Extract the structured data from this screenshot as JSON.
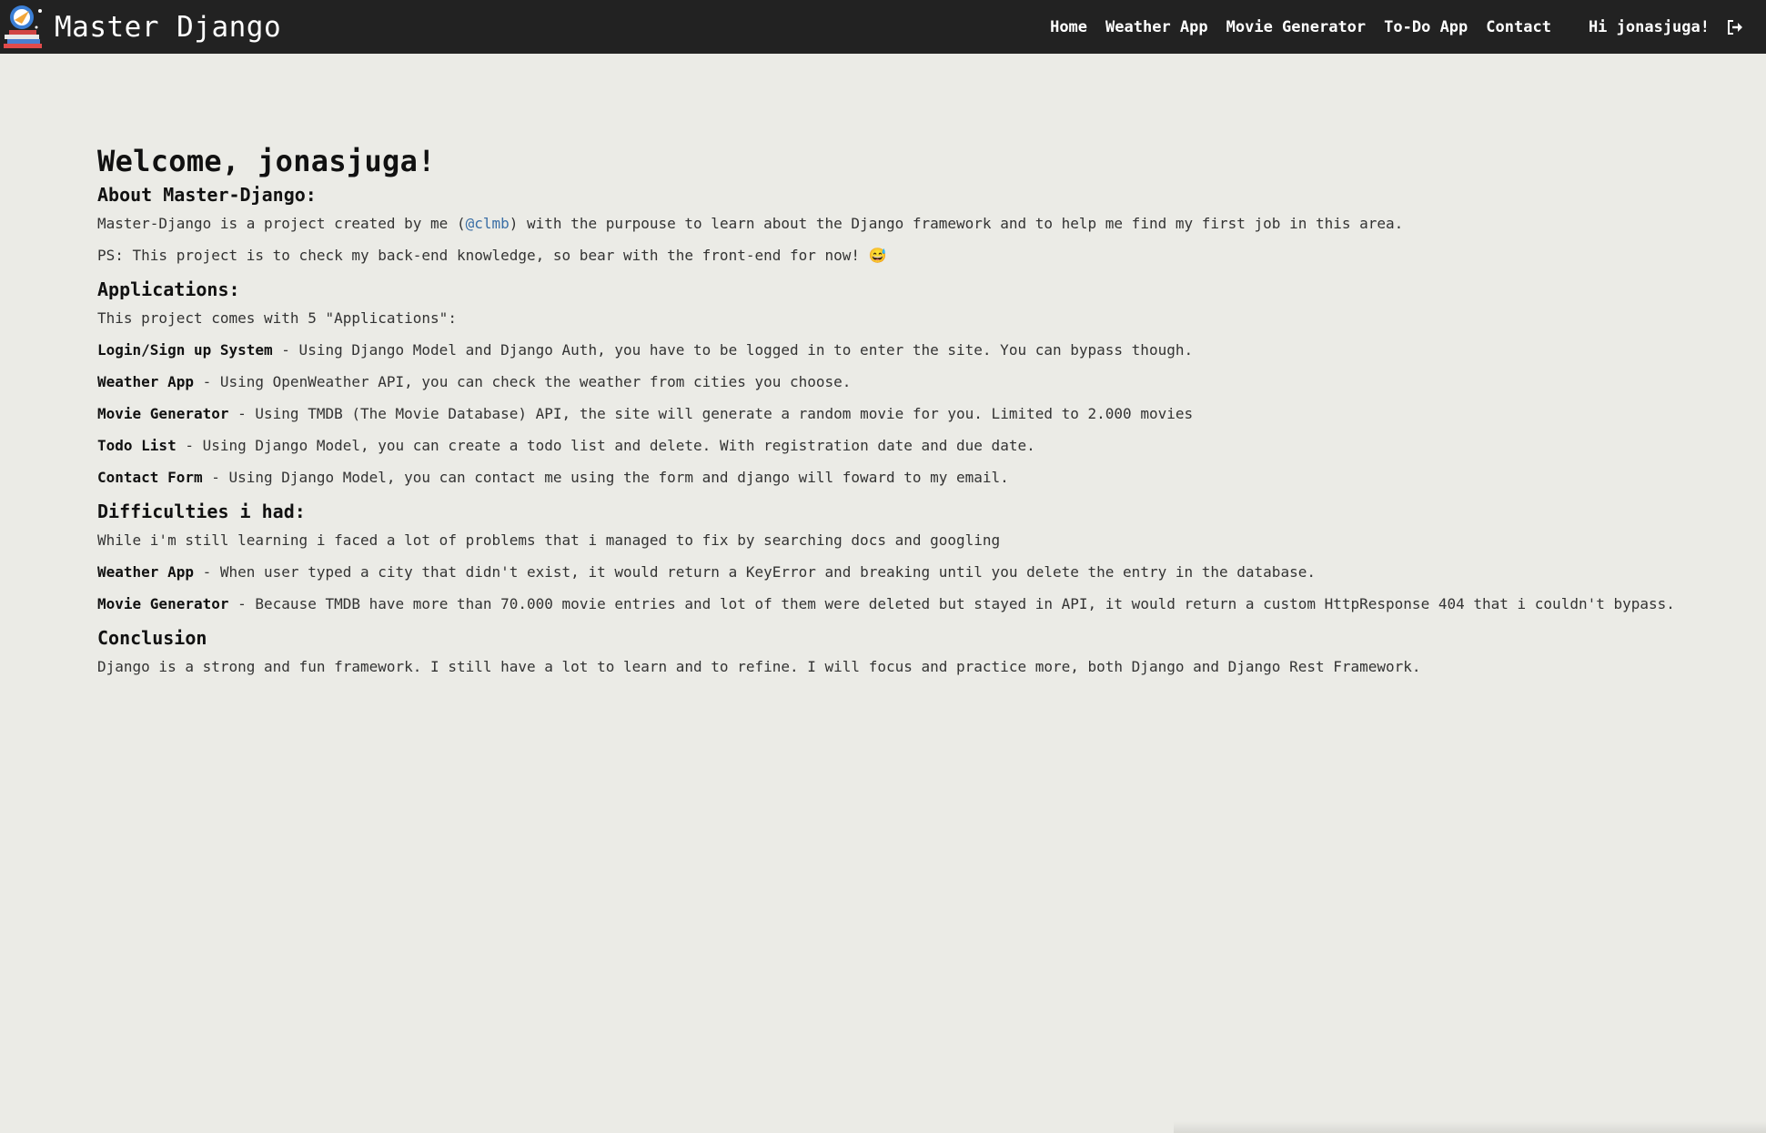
{
  "navbar": {
    "brand": "Master Django",
    "links": [
      "Home",
      "Weather App",
      "Movie Generator",
      "To-Do App",
      "Contact"
    ],
    "greeting": "Hi jonasjuga!"
  },
  "welcome": "Welcome, jonasjuga!",
  "about": {
    "heading": "About Master-Django:",
    "intro_before": "Master-Django is a project created by me (",
    "handle": "@clmb",
    "intro_after": ") with the purpouse to learn about the Django framework and to help me find my first job in this area.",
    "ps": "PS: This project is to check my back-end knowledge, so bear with the front-end for now! 😅"
  },
  "applications": {
    "heading": "Applications:",
    "intro": "This project comes with 5 \"Applications\":",
    "items": [
      {
        "name": "Login/Sign up System",
        "desc": " - Using Django Model and Django Auth, you have to be logged in to enter the site. You can bypass though."
      },
      {
        "name": "Weather App",
        "desc": " - Using OpenWeather API, you can check the weather from cities you choose."
      },
      {
        "name": "Movie Generator",
        "desc": " - Using TMDB (The Movie Database) API, the site will generate a random movie for you. Limited to 2.000 movies"
      },
      {
        "name": "Todo List",
        "desc": " - Using Django Model, you can create a todo list and delete. With registration date and due date."
      },
      {
        "name": "Contact Form",
        "desc": " - Using Django Model, you can contact me using the form and django will foward to my email."
      }
    ]
  },
  "difficulties": {
    "heading": "Difficulties i had:",
    "intro": "While i'm still learning i faced a lot of problems that i managed to fix by searching docs and googling",
    "items": [
      {
        "name": "Weather App",
        "desc": " - When user typed a city that didn't exist, it would return a KeyError and breaking until you delete the entry in the database."
      },
      {
        "name": "Movie Generator",
        "desc": " - Because TMDB have more than 70.000 movie entries and lot of them were deleted but stayed in API, it would return a custom HttpResponse 404 that i couldn't bypass."
      }
    ]
  },
  "conclusion": {
    "heading": "Conclusion",
    "text": "Django is a strong and fun framework. I still have a lot to learn and to refine. I will focus and practice more, both Django and Django Rest Framework."
  }
}
